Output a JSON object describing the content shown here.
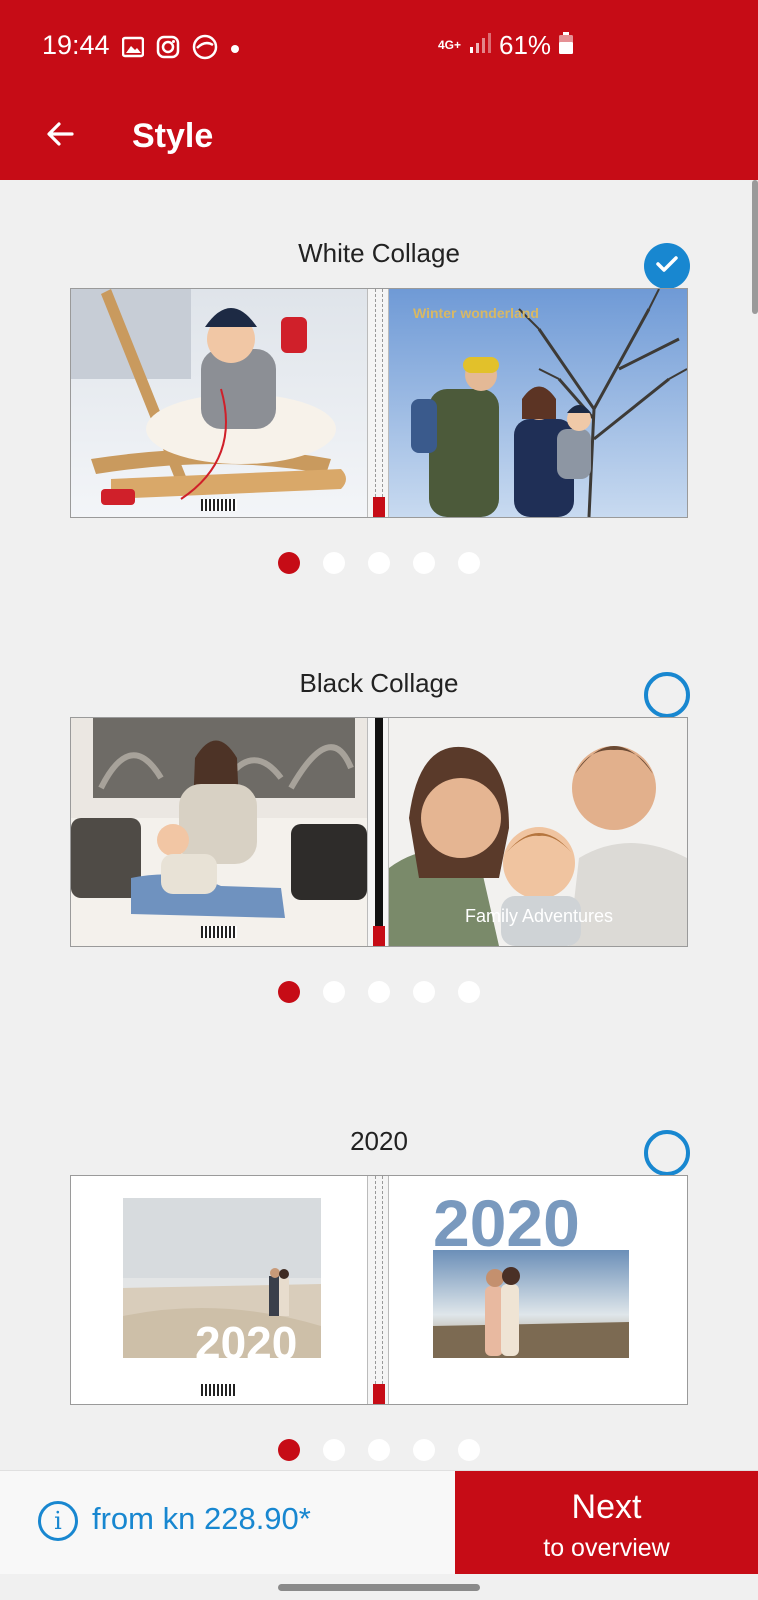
{
  "status": {
    "time": "19:44",
    "network": "4G+",
    "battery": "61%",
    "icons": [
      "gallery-icon",
      "instagram-icon",
      "sync-icon",
      "dot-icon",
      "signal-icon",
      "battery-icon"
    ]
  },
  "header": {
    "title": "Style",
    "back_icon": "arrow-left-icon"
  },
  "styles": [
    {
      "name": "White Collage",
      "selected": true,
      "cover_text": "Winter wonderland",
      "carousel": {
        "count": 5,
        "active": 0
      }
    },
    {
      "name": "Black Collage",
      "selected": false,
      "cover_text": "Family Adventures",
      "carousel": {
        "count": 5,
        "active": 0
      }
    },
    {
      "name": "2020",
      "selected": false,
      "cover_text": "2020",
      "cover_text_right": "2020",
      "carousel": {
        "count": 5,
        "active": 0
      }
    }
  ],
  "footer": {
    "info_icon_glyph": "i",
    "price": "from kn 228.90*",
    "next_label": "Next",
    "next_sub": "to overview"
  },
  "colors": {
    "brand_red": "#c60c16",
    "accent_blue": "#1887d0",
    "background": "#f0f0f0"
  }
}
